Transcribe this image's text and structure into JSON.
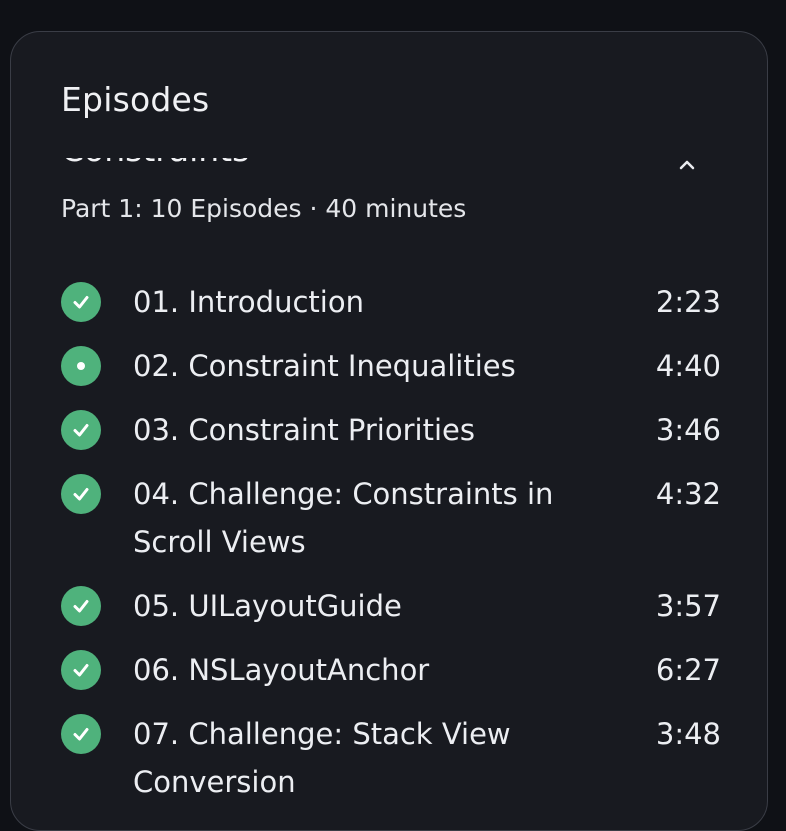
{
  "panel": {
    "title": "Episodes"
  },
  "section": {
    "title": "Constraints",
    "meta": "Part 1: 10 Episodes · 40 minutes",
    "collapse_icon": "chevron-up-icon"
  },
  "colors": {
    "background": "#0f1116",
    "panel": "#181a20",
    "panel_border": "#3a3d46",
    "status_green": "#4fb27c",
    "text": "#eceef2"
  },
  "episodes": [
    {
      "title": "01. Introduction",
      "duration": "2:23",
      "status": "completed"
    },
    {
      "title": "02. Constraint Inequalities",
      "duration": "4:40",
      "status": "in-progress"
    },
    {
      "title": "03. Constraint Priorities",
      "duration": "3:46",
      "status": "completed"
    },
    {
      "title": "04. Challenge: Constraints in Scroll Views",
      "duration": "4:32",
      "status": "completed"
    },
    {
      "title": "05. UILayoutGuide",
      "duration": "3:57",
      "status": "completed"
    },
    {
      "title": "06. NSLayoutAnchor",
      "duration": "6:27",
      "status": "completed"
    },
    {
      "title": "07. Challenge: Stack View Conversion",
      "duration": "3:48",
      "status": "completed"
    }
  ]
}
